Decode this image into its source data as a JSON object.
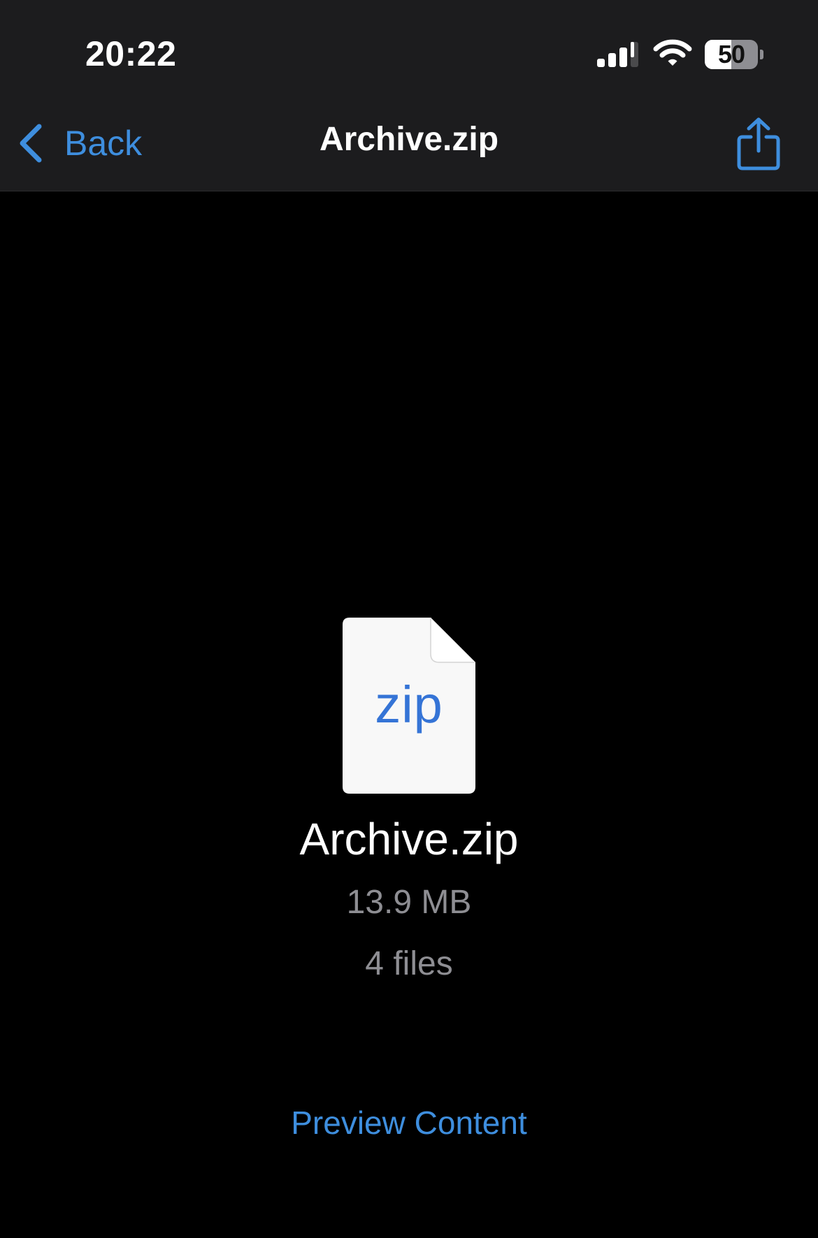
{
  "status_bar": {
    "time": "20:22",
    "battery_level": "50",
    "battery_fraction": 0.5,
    "signal_icon": "cellular-signal-icon",
    "wifi_icon": "wifi-icon"
  },
  "nav_bar": {
    "back_label": "Back",
    "title": "Archive.zip",
    "share_icon": "share-icon"
  },
  "file": {
    "icon_label": "zip",
    "name": "Archive.zip",
    "size": "13.9 MB",
    "count": "4 files"
  },
  "actions": {
    "preview_label": "Preview Content"
  },
  "colors": {
    "accent": "#3e8ede",
    "zip_label": "#3574d6",
    "nav_background": "#1c1c1e",
    "background": "#000000",
    "secondary_text": "#8e8e93"
  }
}
